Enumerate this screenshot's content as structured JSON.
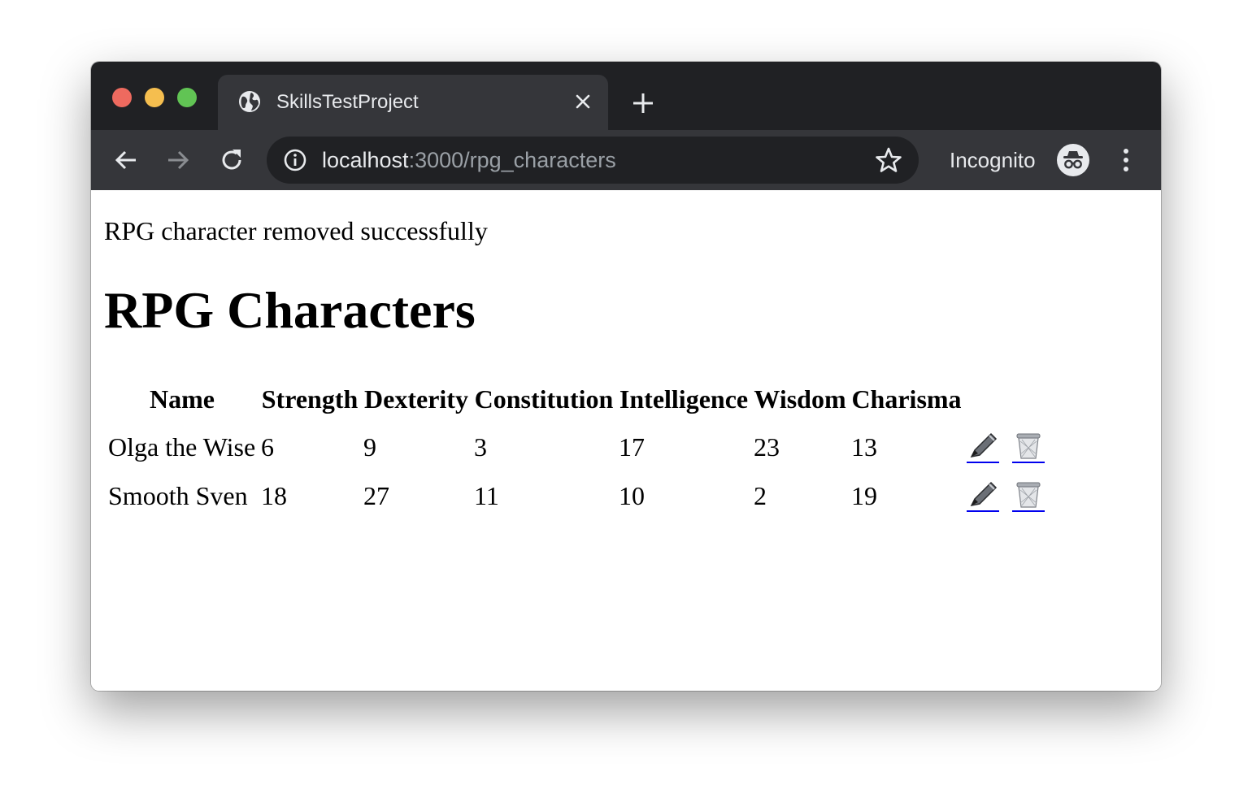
{
  "browser": {
    "tab": {
      "title": "SkillsTestProject",
      "icon": "globe-icon"
    },
    "url": {
      "host": "localhost",
      "path": ":3000/rpg_characters"
    },
    "profile_label": "Incognito"
  },
  "page": {
    "notice": "RPG character removed successfully",
    "heading": "RPG Characters",
    "table": {
      "headers": [
        "Name",
        "Strength",
        "Dexterity",
        "Constitution",
        "Intelligence",
        "Wisdom",
        "Charisma"
      ],
      "rows": [
        {
          "name": "Olga the Wise",
          "strength": "6",
          "dexterity": "9",
          "constitution": "3",
          "intelligence": "17",
          "wisdom": "23",
          "charisma": "13"
        },
        {
          "name": "Smooth Sven",
          "strength": "18",
          "dexterity": "27",
          "constitution": "11",
          "intelligence": "10",
          "wisdom": "2",
          "charisma": "19"
        }
      ],
      "row_actions": [
        {
          "icon": "pencil-icon"
        },
        {
          "icon": "trash-icon"
        }
      ]
    }
  },
  "colors": {
    "titlebar": "#202124",
    "toolbar": "#35363a",
    "link_underline": "#0000ee",
    "traffic_close": "#ee6a5f",
    "traffic_minimize": "#f5be4f",
    "traffic_maximize": "#61c454"
  }
}
